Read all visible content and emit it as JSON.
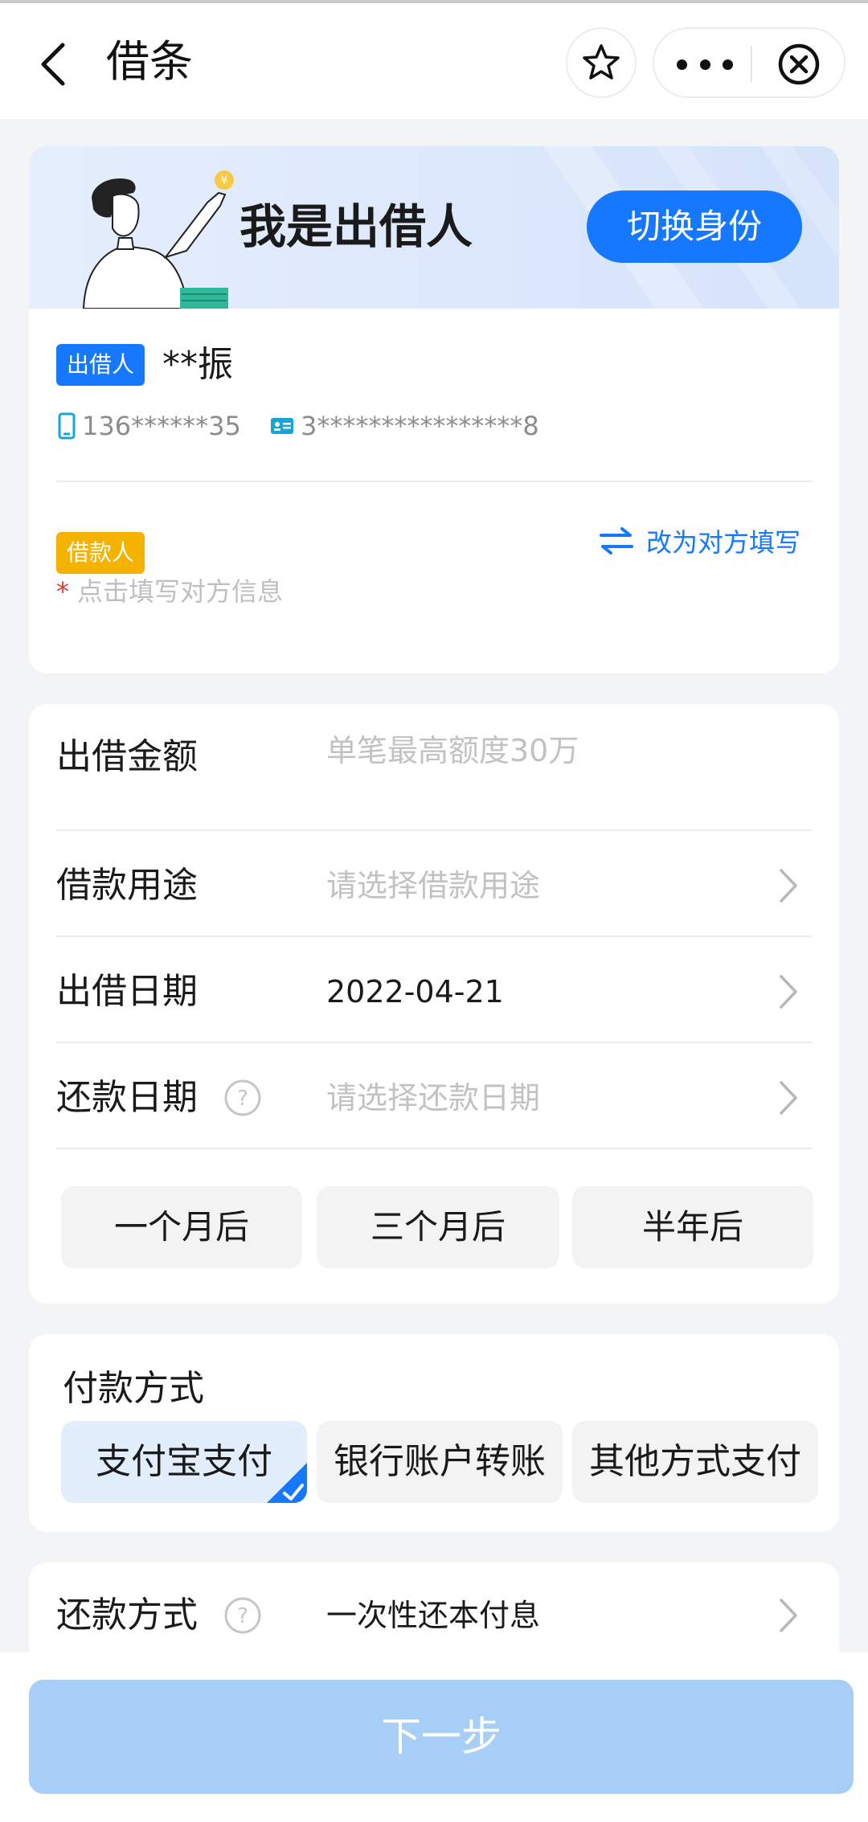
{
  "header": {
    "title": "借条"
  },
  "identity": {
    "banner_title": "我是出借人",
    "switch_label": "切换身份",
    "lender_tag": "出借人",
    "lender_name": "**振",
    "lender_phone": "136******35",
    "lender_id": "3****************8",
    "borrower_tag": "借款人",
    "swap_label": "改为对方填写",
    "required_mark": "*",
    "borrower_hint": "点击填写对方信息"
  },
  "form": {
    "amount": {
      "label": "出借金额",
      "placeholder": "单笔最高额度30万"
    },
    "purpose": {
      "label": "借款用途",
      "placeholder": "请选择借款用途"
    },
    "lend_date": {
      "label": "出借日期",
      "value": "2022-04-21"
    },
    "repay_date": {
      "label": "还款日期",
      "placeholder": "请选择还款日期"
    },
    "quick_options": [
      "一个月后",
      "三个月后",
      "半年后"
    ]
  },
  "payment": {
    "title": "付款方式",
    "options": [
      "支付宝支付",
      "银行账户转账",
      "其他方式支付"
    ],
    "selected_index": 0
  },
  "repay_method": {
    "label": "还款方式",
    "value": "一次性还本付息"
  },
  "footer": {
    "next_label": "下一步"
  },
  "colors": {
    "accent": "#1677ff",
    "borrower_tag": "#f5b300",
    "next_disabled": "#a6cef6"
  }
}
